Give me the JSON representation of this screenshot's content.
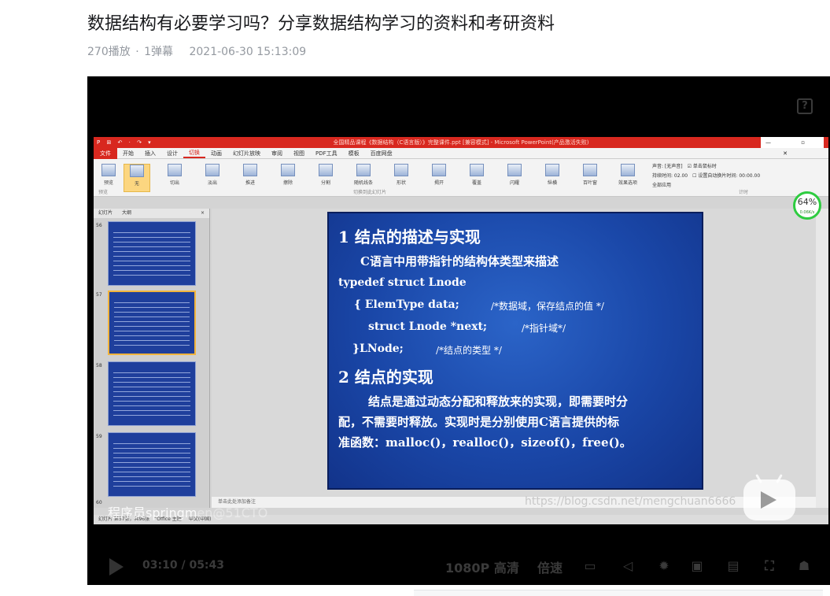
{
  "page": {
    "title": "数据结构有必要学习吗？分享数据结构学习的资料和考研资料",
    "plays": "270播放",
    "separator": "·",
    "danmaku": "1弹幕",
    "date": "2021-06-30 15:13:09"
  },
  "player": {
    "help_label": "?",
    "time_current": "03:10",
    "time_sep": "/",
    "time_total": "05:43",
    "quality": "1080P 高清",
    "speed": "倍速",
    "watermark_main": "程序员springm",
    "watermark_faded": "en@51CTO",
    "csdn_watermark": "https://blog.csdn.net/mengchuan6666",
    "icons": [
      "danmaku-toggle-icon",
      "mute-icon",
      "settings-icon",
      "pip-icon",
      "widescreen-icon",
      "fullscreen-icon",
      "sleep-icon"
    ]
  },
  "ppt": {
    "window_title": "全国精品课程《数据结构（C语言版）》完整课件.ppt [兼容模式] - Microsoft PowerPoint(产品激活失败)",
    "quick_access": "P ⊞ ↶ · ↷ ▾",
    "menu": {
      "file": "文件",
      "tabs": [
        "开始",
        "插入",
        "设计",
        "切换",
        "动画",
        "幻灯片放映",
        "审阅",
        "视图",
        "PDF工具",
        "模板",
        "百度网盘"
      ],
      "active_index": 3
    },
    "ribbon": {
      "preview": "预览",
      "buttons": [
        "无",
        "切出",
        "淡出",
        "推进",
        "擦除",
        "分割",
        "随机线条",
        "形状",
        "揭开",
        "覆盖",
        "闪耀",
        "纵横",
        "百叶窗"
      ],
      "effect_options": "效果选项",
      "group_label_1": "预览",
      "group_label_2": "切换到此幻灯片",
      "group_label_3": "计时",
      "sound": "声音: [无声音]",
      "duration": "持续时间: 02.00",
      "apply_all": "全部应用",
      "on_click": "单击鼠标时",
      "auto_after": "设置自动换片时间: 00:00.00"
    },
    "thumb_tabs": [
      "幻灯片",
      "大纲"
    ],
    "thumb_close": "×",
    "thumbs": [
      {
        "num": "56"
      },
      {
        "num": "57"
      },
      {
        "num": "58"
      },
      {
        "num": "59"
      },
      {
        "num": "60"
      }
    ],
    "notes": "单击此处添加备注",
    "status": "幻灯片 第57张，共96张　“Office 主题”　中文(中国)",
    "badge": {
      "value": "64",
      "unit": "%",
      "sub": "0.06K/s"
    }
  },
  "slide": {
    "heading1": "1  结点的描述与实现",
    "line1": "C语言中用带指针的结构体类型来描述",
    "code1": "typedef  struct  Lnode",
    "code2": "{   ElemType  data;",
    "code2_comment": "/*数据域，保存结点的值 */",
    "code3": "struct   Lnode  *next;",
    "code3_comment": "/*指针域*/",
    "code4": "}LNode;",
    "code4_comment": "/*结点的类型 */",
    "heading2": "2  结点的实现",
    "body1": "结点是通过动态分配和释放来的实现，即需要时分",
    "body2": "配，不需要时释放。实现时是分别使用C语言提供的标",
    "body3": "准函数：malloc()，realloc()，sizeof()，free()。"
  }
}
